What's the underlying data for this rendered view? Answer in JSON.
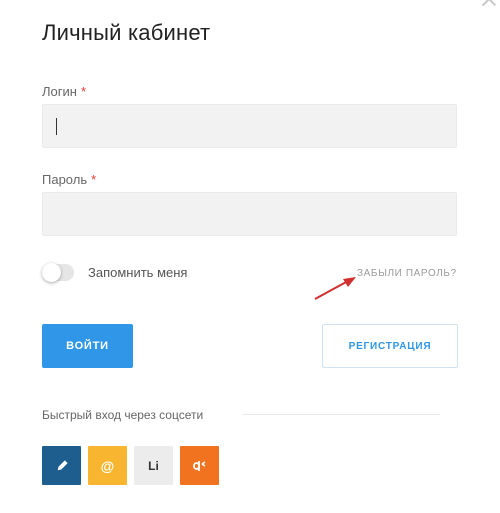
{
  "dialog": {
    "title": "Личный кабинет",
    "close_icon": "close-icon"
  },
  "login": {
    "label": "Логин",
    "required_mark": "*",
    "value": ""
  },
  "password": {
    "label": "Пароль",
    "required_mark": "*",
    "value": ""
  },
  "remember": {
    "label": "Запомнить меня",
    "checked": false
  },
  "forgot_link": "ЗАБЫЛИ ПАРОЛЬ?",
  "buttons": {
    "login": "ВОЙТИ",
    "register": "РЕГИСТРАЦИЯ"
  },
  "social": {
    "title": "Быстрый вход через соцсети",
    "items": [
      {
        "icon": "pen-icon",
        "label": "",
        "color": "#1d5e8e"
      },
      {
        "icon": "mail-at-icon",
        "label": "@",
        "color": "#f8b52f"
      },
      {
        "icon": "livejournal-icon",
        "label": "Li",
        "color": "#ececec"
      },
      {
        "icon": "odnoklassniki-icon",
        "label": "",
        "color": "#f1731f"
      }
    ]
  },
  "colors": {
    "accent": "#2f96e8",
    "required": "#e53935",
    "annotation_arrow": "#d32f2f"
  }
}
